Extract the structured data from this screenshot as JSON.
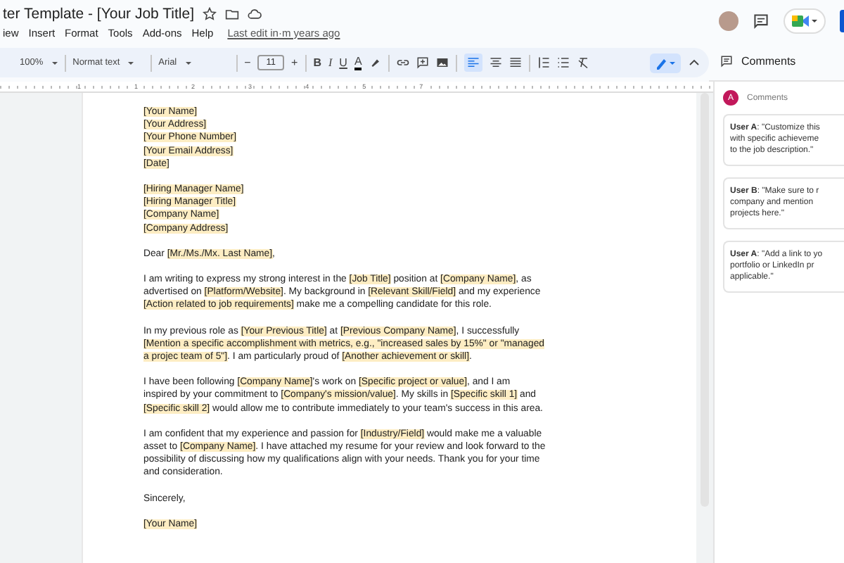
{
  "document_title": "ter Template - [Your Job Title]",
  "menu": [
    "iew",
    "Insert",
    "Format",
    "Tools",
    "Add-ons",
    "Help"
  ],
  "last_edit": "Last edit in·m years ago",
  "toolbar": {
    "zoom": "100%",
    "style": "Normat text",
    "font": "Arial",
    "minus": "−",
    "font_size": "11",
    "plus": "+",
    "bold": "B",
    "italic": "I",
    "underline": "U",
    "text_color": "A"
  },
  "ruler_marks": [
    "1",
    "1",
    "2",
    "3",
    "4",
    "5",
    "7"
  ],
  "letter": [
    [
      [
        {
          "text": "[Your Name]",
          "highlight": true
        }
      ],
      [
        {
          "text": "[Your Address]",
          "highlight": true
        }
      ],
      [
        {
          "text": "[Your Phone Number]",
          "highlight": true
        }
      ],
      [
        {
          "text": "[Your Email Address]",
          "highlight": true
        }
      ],
      [
        {
          "text": "[Date]",
          "highlight": true
        }
      ]
    ],
    [
      [
        {
          "text": "[Hiring Manager Name]",
          "highlight": true
        }
      ],
      [
        {
          "text": "[Hiring Manager Title]",
          "highlight": true
        }
      ],
      [
        {
          "text": "[Company Name]",
          "highlight": true
        }
      ],
      [
        {
          "text": "[Company Address]",
          "highlight": true
        }
      ]
    ],
    [
      [
        {
          "text": "Dear ",
          "highlight": false
        },
        {
          "text": "[Mr./Ms./Mx. Last Name]",
          "highlight": true
        },
        {
          "text": ",",
          "highlight": false
        }
      ]
    ],
    [
      [
        {
          "text": "I am writing to express my strong interest in the ",
          "highlight": false
        },
        {
          "text": "[Job Title]",
          "highlight": true
        },
        {
          "text": " position at ",
          "highlight": false
        },
        {
          "text": "[Company Name]",
          "highlight": true
        },
        {
          "text": ", as advertised on ",
          "highlight": false
        },
        {
          "text": "[Platform/Website]",
          "highlight": true
        },
        {
          "text": ". My background in ",
          "highlight": false
        },
        {
          "text": "[Relevant Skill/Field]",
          "highlight": true
        },
        {
          "text": " and my experience ",
          "highlight": false
        },
        {
          "text": "[Action related to job requirements]",
          "highlight": true
        },
        {
          "text": " make me a compelling candidate for this role.",
          "highlight": false
        }
      ]
    ],
    [
      [
        {
          "text": "In my previous role as ",
          "highlight": false
        },
        {
          "text": "[Your Previous Title]",
          "highlight": true
        },
        {
          "text": " at ",
          "highlight": false
        },
        {
          "text": "[Previous Company Name]",
          "highlight": true
        },
        {
          "text": ", I successfully ",
          "highlight": false
        },
        {
          "text": "[Mention a specific accomplishment with metrics, e.g., \"increased sales by 15%\" or \"managed a projec team of 5\"]",
          "highlight": true
        },
        {
          "text": ". I am particularly proud of ",
          "highlight": false
        },
        {
          "text": "[Another achievement or skill]",
          "highlight": true
        },
        {
          "text": ".",
          "highlight": false
        }
      ]
    ],
    [
      [
        {
          "text": "I have been following ",
          "highlight": false
        },
        {
          "text": "[Company Name]",
          "highlight": true
        },
        {
          "text": "'s work on ",
          "highlight": false
        },
        {
          "text": "[Specific project or value]",
          "highlight": true
        },
        {
          "text": ", and I am inspired by your commitment to ",
          "highlight": false
        },
        {
          "text": "[Company's mission/value]",
          "highlight": true
        },
        {
          "text": ". My skills in ",
          "highlight": false
        },
        {
          "text": "[Specific skill 1]",
          "highlight": true
        },
        {
          "text": " and ",
          "highlight": false
        },
        {
          "text": "[Specific skill 2]",
          "highlight": true
        },
        {
          "text": " would allow me to contribute immediately to your team's success in this area.",
          "highlight": false
        }
      ]
    ],
    [
      [
        {
          "text": "I am confident that my experience and passion for ",
          "highlight": false
        },
        {
          "text": "[Industry/Field]",
          "highlight": true
        },
        {
          "text": " would make me a valuable asset to ",
          "highlight": false
        },
        {
          "text": "[Company Name]",
          "highlight": true
        },
        {
          "text": ". I have attached my resume for your review and look forward to the possibility of discussing how my qualifications align with your needs. Thank you for your time and consideration.",
          "highlight": false
        }
      ]
    ],
    [
      [
        {
          "text": "Sincerely,",
          "highlight": false
        }
      ]
    ],
    [
      [
        {
          "text": "[Your Name]",
          "highlight": true
        }
      ]
    ]
  ],
  "comments_panel": {
    "title": "Comments",
    "avatar_letter": "A",
    "label": "Comments",
    "comments": [
      {
        "lines": [
          "**User A**: \"Customize this",
          "with specific achieveme",
          "to the job description.\""
        ]
      },
      {
        "lines": [
          "**User B**: \"Make sure to r",
          "company and mention",
          "projects here.\""
        ]
      },
      {
        "lines": [
          "**User A**: \"Add a link to yo",
          "portfolio or LinkedIn pr",
          "applicable.\""
        ]
      }
    ]
  }
}
